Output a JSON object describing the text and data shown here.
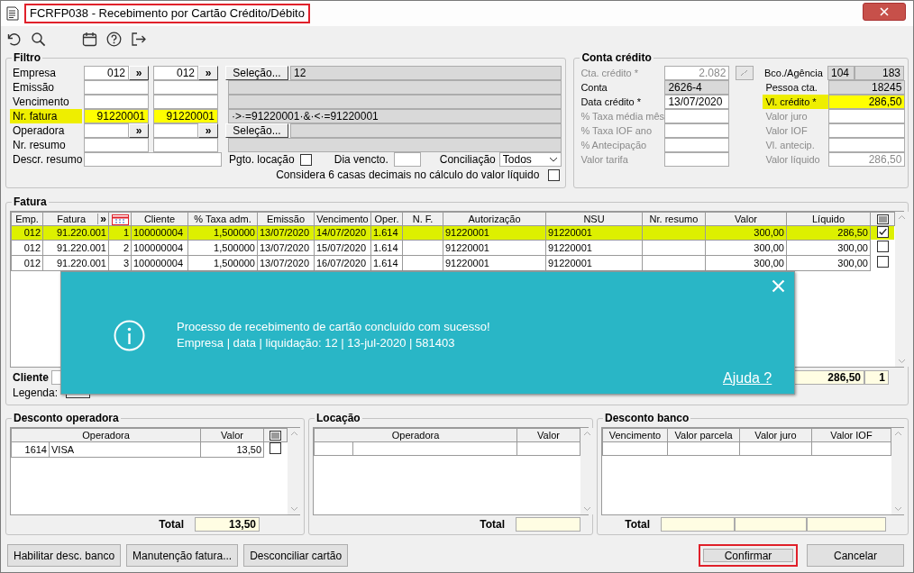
{
  "window": {
    "title": "FCRFP038 - Recebimento por Cartão Crédito/Débito",
    "annotated": true
  },
  "filtro": {
    "title": "Filtro",
    "rows": [
      {
        "label": "Empresa",
        "highlighted": false,
        "from_value": "012",
        "to_value": "012",
        "lookups": [
          "»",
          "»"
        ],
        "button": "Seleção...",
        "display": "12"
      },
      {
        "label": "Emissão",
        "highlighted": false
      },
      {
        "label": "Vencimento",
        "highlighted": false
      },
      {
        "label": "Nr. fatura",
        "highlighted": true,
        "from_value": "91220001",
        "to_value": "91220001",
        "display": "·>·=91220001·&·<·=91220001"
      },
      {
        "label": "Operadora",
        "highlighted": false,
        "lookups": [
          "»",
          "»"
        ],
        "button": "Seleção..."
      },
      {
        "label": "Nr. resumo",
        "highlighted": false
      }
    ],
    "descr_resumo": {
      "label": "Descr. resumo"
    },
    "pgto_locacao": {
      "label": "Pgto. locação",
      "checked": false
    },
    "dia_vencto": {
      "label": "Dia vencto."
    },
    "conciliacao": {
      "label": "Conciliação",
      "value": "Todos"
    },
    "seis_casas": {
      "label": "Considera 6 casas decimais no cálculo do valor líquido",
      "checked": false
    }
  },
  "conta_credito": {
    "title": "Conta crédito",
    "left": [
      {
        "label": "Cta. crédito *",
        "disabled": true,
        "highlighted": false,
        "picker": true,
        "fields": [
          {
            "value": "2.082",
            "kind": "number",
            "readonly": false
          }
        ]
      },
      {
        "label": "Conta",
        "disabled": false,
        "highlighted": false,
        "fields": [
          {
            "value": "2626-4",
            "kind": "text",
            "readonly": true
          }
        ]
      },
      {
        "label": "Data crédito *",
        "disabled": false,
        "highlighted": false,
        "fields": [
          {
            "value": "13/07/2020",
            "kind": "text",
            "readonly": false
          }
        ]
      },
      {
        "label": "% Taxa média mês",
        "disabled": true,
        "highlighted": false,
        "fields": [
          {
            "kind": "number",
            "readonly": false
          }
        ]
      },
      {
        "label": "% Taxa IOF ano",
        "disabled": true,
        "highlighted": false,
        "fields": [
          {
            "kind": "number",
            "readonly": false
          }
        ]
      },
      {
        "label": "% Antecipação",
        "disabled": true,
        "highlighted": false,
        "fields": [
          {
            "kind": "number",
            "readonly": false
          }
        ]
      },
      {
        "label": "Valor tarifa",
        "disabled": true,
        "highlighted": false,
        "fields": [
          {
            "kind": "number",
            "readonly": false
          }
        ]
      }
    ],
    "right": [
      {
        "label": "Bco./Agência",
        "disabled": false,
        "highlighted": false,
        "fields": [
          {
            "value": "104",
            "kind": "text",
            "readonly": true
          },
          {
            "value": "183",
            "kind": "number",
            "readonly": true
          }
        ]
      },
      {
        "label": "Pessoa cta.",
        "disabled": false,
        "highlighted": false,
        "fields": [
          {
            "value": "18245",
            "kind": "number",
            "readonly": true
          }
        ]
      },
      {
        "label": "Vl. crédito *",
        "disabled": false,
        "highlighted": true,
        "fields": [
          {
            "value": "286,50",
            "kind": "number",
            "readonly": false
          }
        ]
      },
      {
        "label": "Valor juro",
        "disabled": true,
        "highlighted": false,
        "fields": [
          {
            "kind": "number",
            "readonly": false
          }
        ]
      },
      {
        "label": "Valor IOF",
        "disabled": true,
        "highlighted": false,
        "fields": [
          {
            "kind": "number",
            "readonly": false
          }
        ]
      },
      {
        "label": "Vl. antecip.",
        "disabled": true,
        "highlighted": false,
        "fields": [
          {
            "kind": "number",
            "readonly": false
          }
        ]
      },
      {
        "label": "Valor líquido",
        "disabled": true,
        "highlighted": false,
        "fields": [
          {
            "value": "286,50",
            "kind": "number",
            "readonly": false
          }
        ]
      }
    ]
  },
  "fatura": {
    "title": "Fatura",
    "columns": [
      {
        "kind": "text",
        "label": "Emp."
      },
      {
        "kind": "text",
        "label": "Fatura",
        "button": "»"
      },
      {
        "kind": "calendar"
      },
      {
        "kind": "text",
        "label": "Cliente"
      },
      {
        "kind": "text",
        "label": "% Taxa adm."
      },
      {
        "kind": "text",
        "label": "Emissão"
      },
      {
        "kind": "text",
        "label": "Vencimento"
      },
      {
        "kind": "text",
        "label": "Oper."
      },
      {
        "kind": "text",
        "label": "N. F."
      },
      {
        "kind": "text",
        "label": "Autorização"
      },
      {
        "kind": "text",
        "label": "NSU"
      },
      {
        "kind": "text",
        "label": "Nr. resumo"
      },
      {
        "kind": "text",
        "label": "Valor"
      },
      {
        "kind": "text",
        "label": "Líquido"
      },
      {
        "kind": "checkbox"
      }
    ],
    "rows": [
      {
        "selected": true,
        "checked": true,
        "cells": [
          "012",
          "91.220.001",
          "1",
          "100000004",
          "1,500000",
          "13/07/2020",
          "14/07/2020",
          "1.614",
          null,
          "91220001",
          "91220001",
          null,
          "300,00",
          "286,50"
        ]
      },
      {
        "selected": false,
        "checked": false,
        "cells": [
          "012",
          "91.220.001",
          "2",
          "100000004",
          "1,500000",
          "13/07/2020",
          "15/07/2020",
          "1.614",
          null,
          "91220001",
          "91220001",
          null,
          "300,00",
          "300,00"
        ]
      },
      {
        "selected": false,
        "checked": false,
        "cells": [
          "012",
          "91.220.001",
          "3",
          "100000004",
          "1,500000",
          "13/07/2020",
          "16/07/2020",
          "1.614",
          null,
          "91220001",
          "91220001",
          null,
          "300,00",
          "300,00"
        ]
      }
    ],
    "footer": {
      "label": "Cliente",
      "total": "286,50",
      "count": "1",
      "legend_label": "Legenda:"
    }
  },
  "notification": {
    "message": "Processo de recebimento de cartão concluído com sucesso!",
    "detail": "Empresa | data | liquidação: 12 | 13-jul-2020 | 581403",
    "help_link": "Ajuda ?"
  },
  "desconto_operadora": {
    "title": "Desconto operadora",
    "columns": [
      {
        "kind": "text",
        "label": "Operadora"
      },
      {
        "kind": "text",
        "label": "Valor"
      },
      {
        "kind": "checkbox"
      }
    ],
    "rows": [
      {
        "code": "1614",
        "name": "VISA",
        "valor": "13,50",
        "checked": false
      }
    ],
    "total_label": "Total",
    "total": "13,50"
  },
  "locacao": {
    "title": "Locação",
    "columns": [
      {
        "kind": "text",
        "label": "Operadora"
      },
      {
        "kind": "text",
        "label": "Valor"
      }
    ],
    "total_label": "Total"
  },
  "desconto_banco": {
    "title": "Desconto banco",
    "columns": [
      {
        "kind": "text",
        "label": "Vencimento"
      },
      {
        "kind": "text",
        "label": "Valor parcela"
      },
      {
        "kind": "text",
        "label": "Valor juro"
      },
      {
        "kind": "text",
        "label": "Valor IOF"
      }
    ],
    "total_label": "Total"
  },
  "buttons_left": [
    "Habilitar desc. banco",
    "Manutenção fatura...",
    "Desconciliar cartão"
  ],
  "buttons_right": [
    {
      "label": "Confirmar",
      "annotated": true
    },
    {
      "label": "Cancelar",
      "annotated": false
    }
  ]
}
